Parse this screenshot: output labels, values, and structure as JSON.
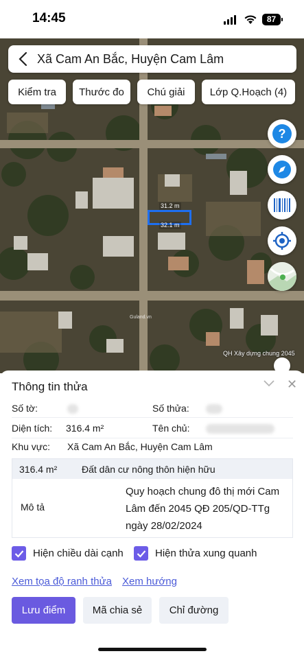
{
  "status_bar": {
    "time": "14:45",
    "battery": "87"
  },
  "search": {
    "title": "Xã Cam An Bắc, Huyện Cam Lâm"
  },
  "toolbar": [
    {
      "label": "Kiểm tra"
    },
    {
      "label": "Thước đo"
    },
    {
      "label": "Chú giải"
    },
    {
      "label": "Lớp Q.Hoạch (4)"
    }
  ],
  "map": {
    "measure_top": "31.2 m",
    "measure_bottom": "32.1 m",
    "watermark": "QH Xây dựng chung 2045",
    "logo_text": "Guland.vn",
    "side_buttons": [
      "help-icon",
      "compass-icon",
      "barcode-icon",
      "locate-icon",
      "map-layers-icon"
    ]
  },
  "sheet": {
    "title": "Thông tin thửa",
    "so_to_label": "Số tờ:",
    "so_thua_label": "Số thửa:",
    "dien_tich_label": "Diện tích:",
    "dien_tich_value": "316.4 m²",
    "ten_chu_label": "Tên chủ:",
    "khu_vuc_label": "Khu vực:",
    "khu_vuc_value": "Xã Cam An Bắc, Huyện Cam Lâm",
    "zone_area": "316.4 m²",
    "zone_type": "Đất dân cư nông thôn hiện hữu",
    "mo_ta_label": "Mô tả",
    "mo_ta_line1": "Quy hoạch chung đô thị mới Cam",
    "mo_ta_line2": "Lâm đến 2045 QĐ 205/QD-TTg",
    "mo_ta_line3": "ngày 28/02/2024",
    "checkbox_1": "Hiện chiều dài cạnh",
    "checkbox_2": "Hiện thửa xung quanh",
    "link_1": "Xem tọa độ ranh thửa",
    "link_2": "Xem hướng",
    "btn_save": "Lưu điểm",
    "btn_share": "Mã chia sẻ",
    "btn_directions": "Chỉ đường"
  },
  "colors": {
    "accent": "#6a5ae0",
    "link": "#4a5ad8",
    "measure": "#1e6ff0"
  }
}
